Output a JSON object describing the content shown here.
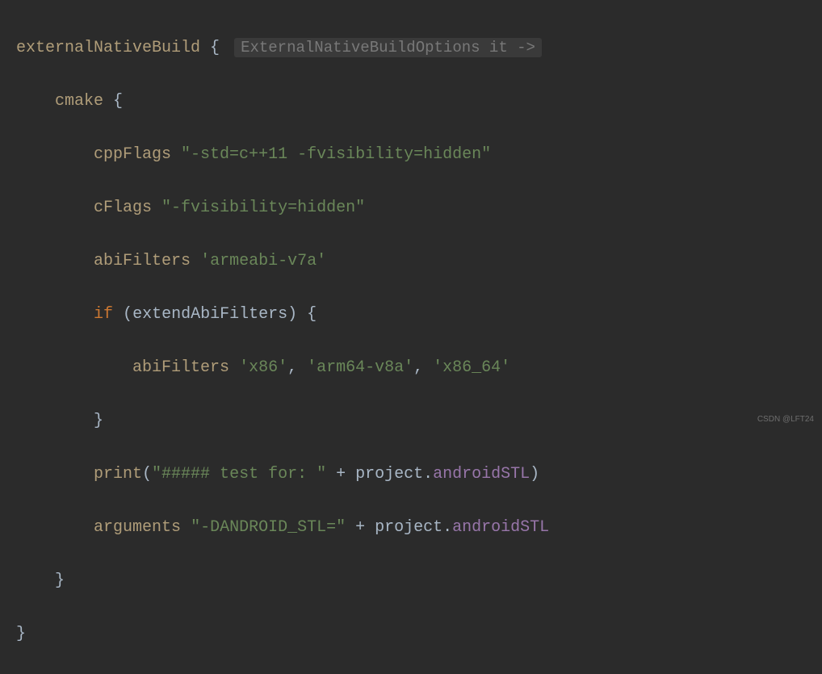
{
  "code": {
    "line1": {
      "method": "externalNativeBuild",
      "brace": " {",
      "hint": "ExternalNativeBuildOptions it ->"
    },
    "line2": {
      "indent": "    ",
      "method": "cmake",
      "brace": " {"
    },
    "line3": {
      "indent": "        ",
      "method": "cppFlags",
      "space": " ",
      "string": "\"-std=c++11 -fvisibility=hidden\""
    },
    "line4": {
      "indent": "        ",
      "method": "cFlags",
      "space": " ",
      "string": "\"-fvisibility=hidden\""
    },
    "line5": {
      "indent": "        ",
      "method": "abiFilters",
      "space": " ",
      "string": "'armeabi-v7a'"
    },
    "line6": {
      "indent": "        ",
      "keyword": "if",
      "space": " ",
      "paren_open": "(",
      "identifier": "extendAbiFilters",
      "paren_close": ")",
      "brace": " {"
    },
    "line7": {
      "indent": "            ",
      "method": "abiFilters",
      "space": " ",
      "str1": "'x86'",
      "comma1": ", ",
      "str2": "'arm64-v8a'",
      "comma2": ", ",
      "str3": "'x86_64'"
    },
    "line8": {
      "indent": "        ",
      "brace": "}"
    },
    "line9": {
      "indent": "        ",
      "method": "print",
      "paren_open": "(",
      "string": "\"##### test for: \"",
      "plus": " + ",
      "obj": "project",
      "dot": ".",
      "prop": "androidSTL",
      "paren_close": ")"
    },
    "line10": {
      "indent": "        ",
      "method": "arguments",
      "space": " ",
      "string": "\"-DANDROID_STL=\"",
      "plus": " + ",
      "obj": "project",
      "dot": ".",
      "prop": "androidSTL"
    },
    "line11": {
      "indent": "    ",
      "brace": "}"
    },
    "line12": {
      "brace": "}"
    }
  },
  "watermark": "CSDN @LFT24"
}
